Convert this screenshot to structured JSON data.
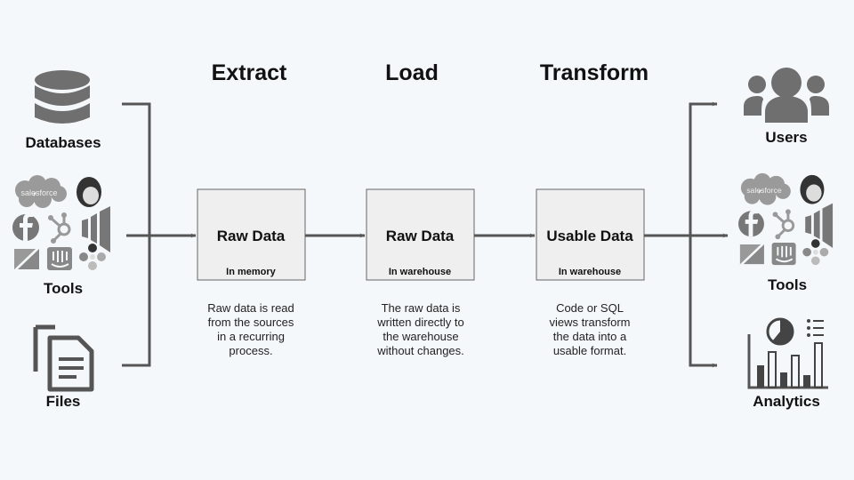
{
  "stages": [
    {
      "heading": "Extract",
      "box_title": "Raw Data",
      "box_subtitle": "In memory",
      "description": [
        "Raw data is read",
        "from the sources",
        "in a recurring",
        "process."
      ]
    },
    {
      "heading": "Load",
      "box_title": "Raw Data",
      "box_subtitle": "In warehouse",
      "description": [
        "The raw data is",
        "written directly to",
        "the warehouse",
        "without changes."
      ]
    },
    {
      "heading": "Transform",
      "box_title": "Usable Data",
      "box_subtitle": "In warehouse",
      "description": [
        "Code or SQL",
        "views transform",
        "the data into a",
        "usable format."
      ]
    }
  ],
  "sources": [
    {
      "label": "Databases",
      "icon": "database-icon"
    },
    {
      "label": "Tools",
      "icon": "tool-logos-icon"
    },
    {
      "label": "Files",
      "icon": "files-icon"
    }
  ],
  "destinations": [
    {
      "label": "Users",
      "icon": "users-icon"
    },
    {
      "label": "Tools",
      "icon": "tool-logos-icon"
    },
    {
      "label": "Analytics",
      "icon": "analytics-icon"
    }
  ],
  "tool_logos": {
    "salesforce_text": "salesforce"
  },
  "colors": {
    "background": "#f5f8fa",
    "lines": "#555555",
    "box_fill": "#efefef",
    "icons": "#6f6f6f"
  }
}
